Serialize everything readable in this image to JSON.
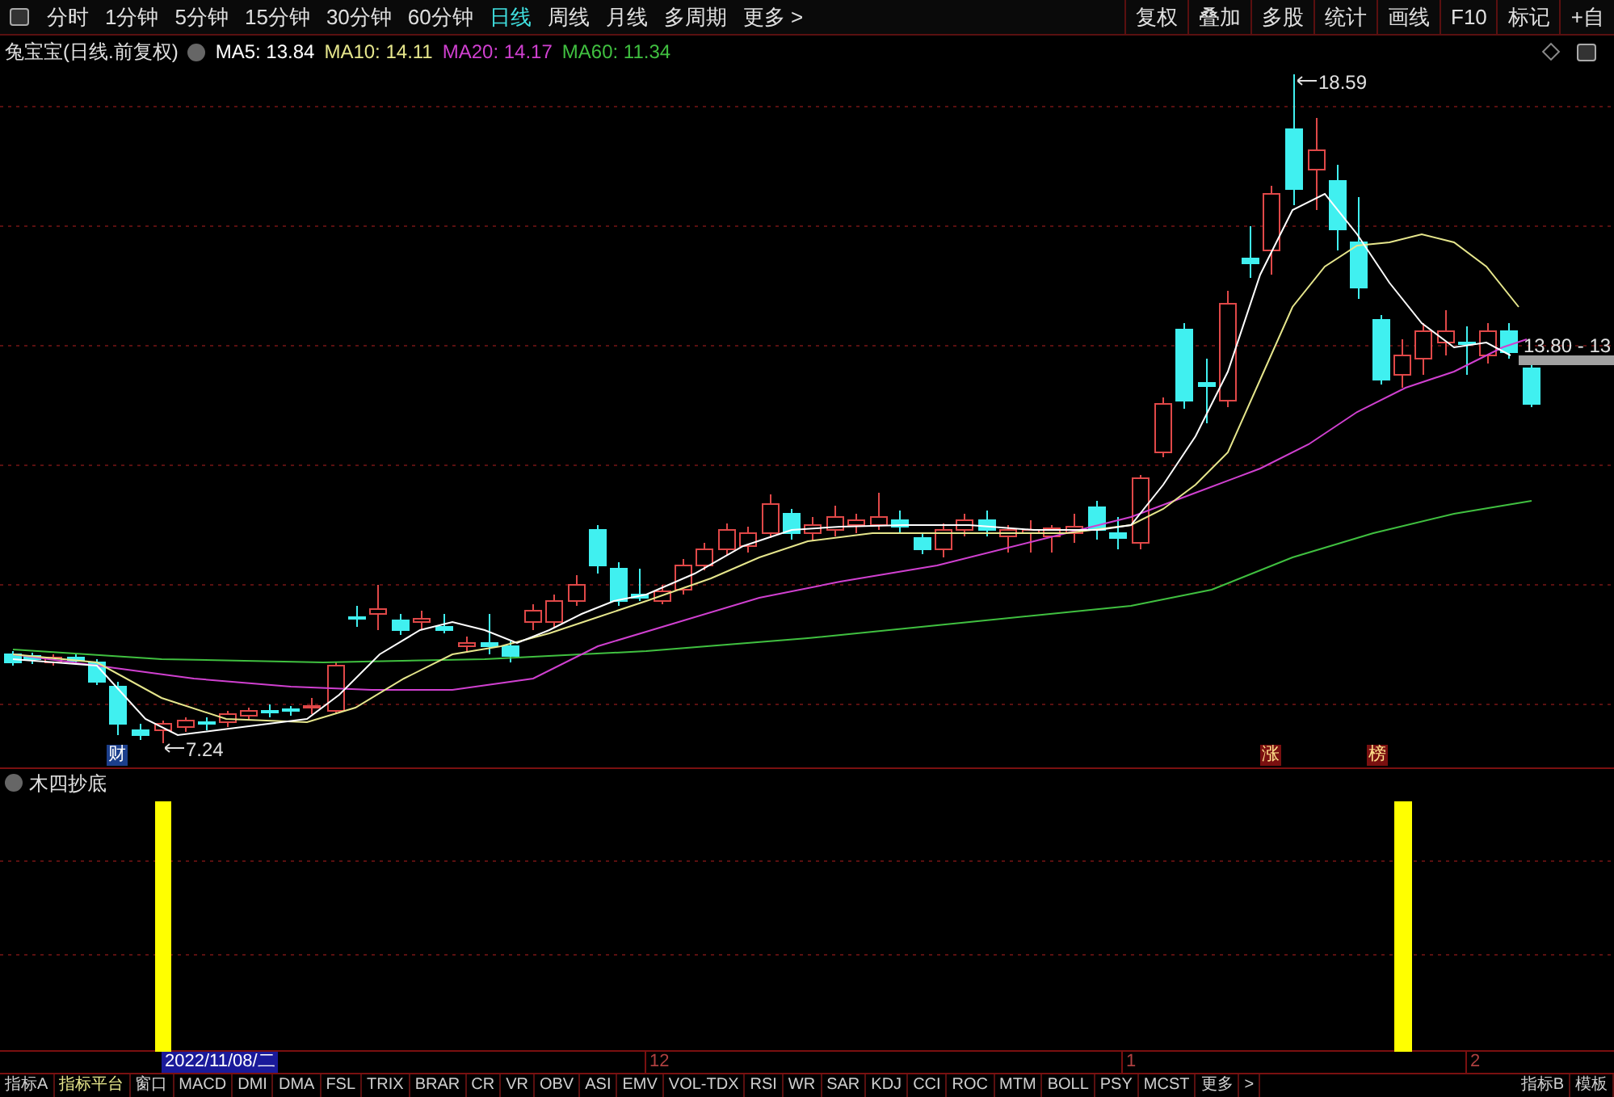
{
  "toolbar": {
    "periods": [
      {
        "label": "分时",
        "selected": false
      },
      {
        "label": "1分钟",
        "selected": false
      },
      {
        "label": "5分钟",
        "selected": false
      },
      {
        "label": "15分钟",
        "selected": false
      },
      {
        "label": "30分钟",
        "selected": false
      },
      {
        "label": "60分钟",
        "selected": false
      },
      {
        "label": "日线",
        "selected": true
      },
      {
        "label": "周线",
        "selected": false
      },
      {
        "label": "月线",
        "selected": false
      },
      {
        "label": "多周期",
        "selected": false
      },
      {
        "label": "更多 >",
        "selected": false
      }
    ],
    "tools": [
      "复权",
      "叠加",
      "多股",
      "统计",
      "画线",
      "F10",
      "标记",
      "+自"
    ]
  },
  "legend": {
    "title": "兔宝宝(日线.前复权)",
    "averages": [
      {
        "label": "MA5: 13.84",
        "color": "#ffffff"
      },
      {
        "label": "MA10: 14.11",
        "color": "#e6e68c"
      },
      {
        "label": "MA20: 14.17",
        "color": "#d040d0"
      },
      {
        "label": "MA60: 11.34",
        "color": "#40c040"
      }
    ]
  },
  "chart": {
    "high_label": "18.59",
    "low_label": "7.24",
    "price_label": "13.80 - 13",
    "badges": [
      {
        "text": "财",
        "kind": "blue"
      },
      {
        "text": "涨",
        "kind": "red"
      },
      {
        "text": "榜",
        "kind": "red"
      }
    ]
  },
  "indicator": {
    "title": "木四抄底"
  },
  "date_axis": {
    "cursor_date": "2022/11/08/二",
    "labels": [
      "12",
      "1",
      "2"
    ]
  },
  "bottom_tabs": [
    {
      "label": "指标A",
      "selected": false
    },
    {
      "label": "指标平台",
      "selected": true
    },
    {
      "label": "窗口",
      "selected": false
    },
    {
      "label": "MACD",
      "selected": false
    },
    {
      "label": "DMI",
      "selected": false
    },
    {
      "label": "DMA",
      "selected": false
    },
    {
      "label": "FSL",
      "selected": false
    },
    {
      "label": "TRIX",
      "selected": false
    },
    {
      "label": "BRAR",
      "selected": false
    },
    {
      "label": "CR",
      "selected": false
    },
    {
      "label": "VR",
      "selected": false
    },
    {
      "label": "OBV",
      "selected": false
    },
    {
      "label": "ASI",
      "selected": false
    },
    {
      "label": "EMV",
      "selected": false
    },
    {
      "label": "VOL-TDX",
      "selected": false
    },
    {
      "label": "RSI",
      "selected": false
    },
    {
      "label": "WR",
      "selected": false
    },
    {
      "label": "SAR",
      "selected": false
    },
    {
      "label": "KDJ",
      "selected": false
    },
    {
      "label": "CCI",
      "selected": false
    },
    {
      "label": "ROC",
      "selected": false
    },
    {
      "label": "MTM",
      "selected": false
    },
    {
      "label": "BOLL",
      "selected": false
    },
    {
      "label": "PSY",
      "selected": false
    },
    {
      "label": "MCST",
      "selected": false
    },
    {
      "label": "更多",
      "selected": false
    },
    {
      "label": ">",
      "selected": false
    },
    {
      "label": "指标B",
      "selected": false
    },
    {
      "label": "模板",
      "selected": false
    }
  ]
}
